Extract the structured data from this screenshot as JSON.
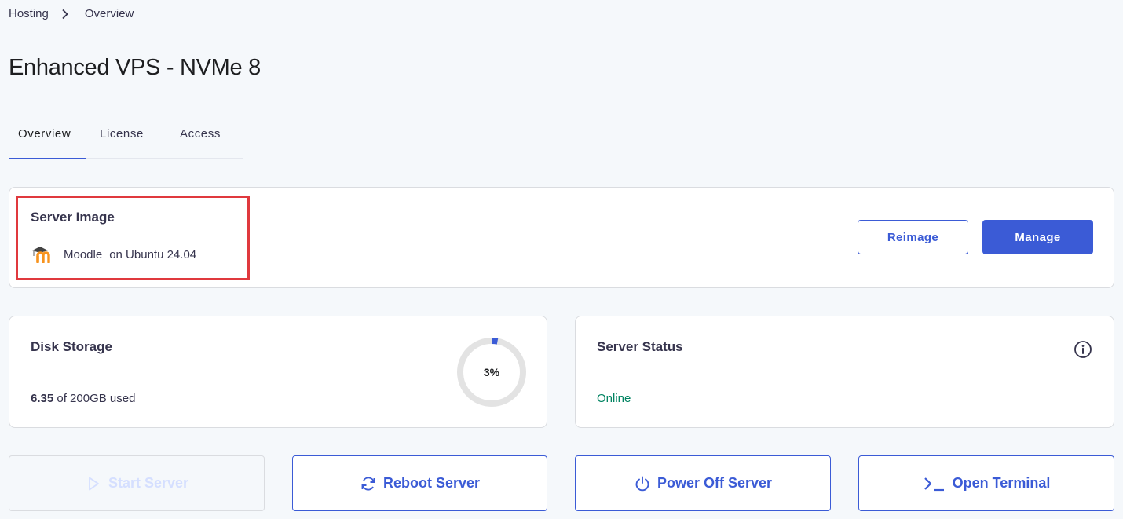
{
  "breadcrumb": {
    "items": [
      "Hosting",
      "Overview"
    ]
  },
  "page": {
    "title": "Enhanced VPS - NVMe 8"
  },
  "tabs": [
    {
      "label": "Overview",
      "active": true
    },
    {
      "label": "License",
      "active": false
    },
    {
      "label": "Access",
      "active": false
    }
  ],
  "server_image": {
    "title": "Server Image",
    "app_name": "Moodle",
    "os": "on Ubuntu 24.04",
    "logo_icon": "moodle-logo",
    "reimage_label": "Reimage",
    "manage_label": "Manage"
  },
  "disk": {
    "title": "Disk Storage",
    "used": "6.35",
    "total_text": " of 200GB used",
    "percent_label": "3%",
    "percent": 3
  },
  "status": {
    "title": "Server Status",
    "value": "Online",
    "info_icon": "info-icon"
  },
  "actions": {
    "start": {
      "label": "Start Server",
      "icon": "play-icon",
      "enabled": false
    },
    "reboot": {
      "label": "Reboot Server",
      "icon": "refresh-icon",
      "enabled": true
    },
    "power": {
      "label": "Power Off Server",
      "icon": "power-icon",
      "enabled": true
    },
    "terminal": {
      "label": "Open Terminal",
      "icon": "terminal-icon",
      "enabled": true
    }
  },
  "colors": {
    "accent": "#3b5bd6",
    "highlight": "#e0393e",
    "online": "#008361",
    "disabled": "#d5dfff"
  }
}
